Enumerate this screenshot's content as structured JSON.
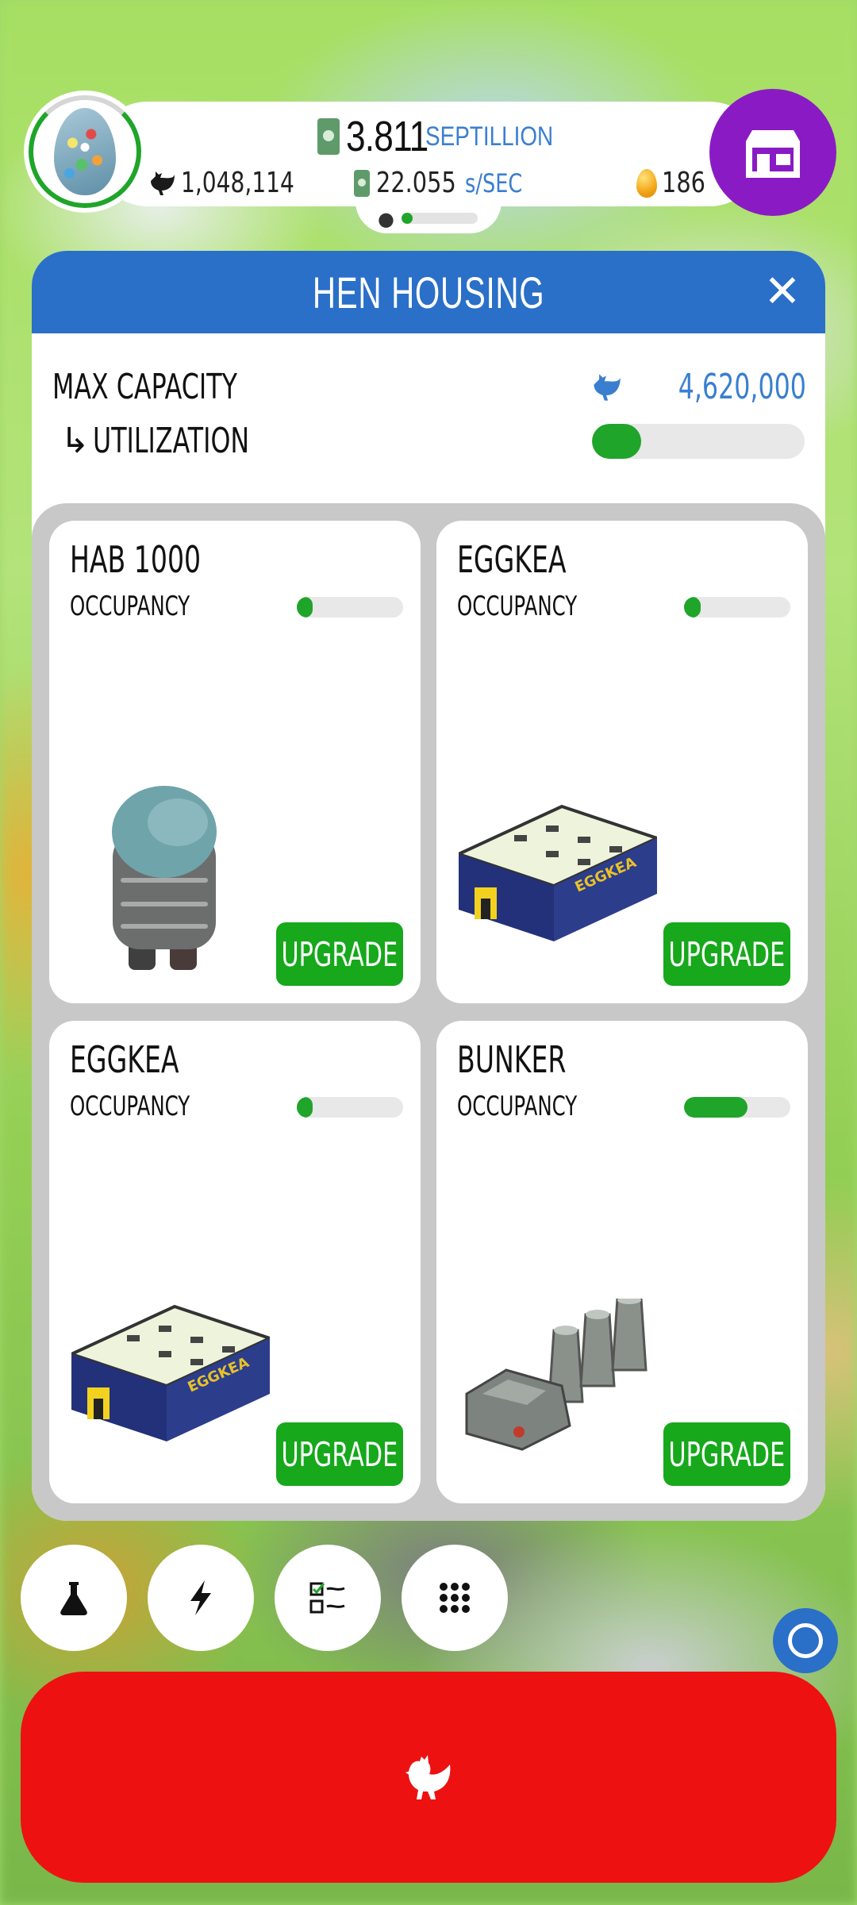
{
  "status_bar": {
    "cash_value": "3.811",
    "cash_unit": "SEPTILLION",
    "rate_value": "22.055",
    "rate_unit": "s/SEC",
    "chicken_count": "1,048,114",
    "golden_eggs": "186",
    "mini_progress_fraction": 0.15
  },
  "panel": {
    "title": "HEN HOUSING",
    "max_capacity_label": "MAX CAPACITY",
    "max_capacity_value": "4,620,000",
    "utilization_label": "UTILIZATION",
    "utilization_arrow": "↳",
    "utilization_fraction": 0.23
  },
  "habs": [
    {
      "name": "HAB 1000",
      "occupancy_label": "OCCUPANCY",
      "occupancy_fraction": 0.08,
      "upgrade_label": "UPGRADE",
      "image": "hab-1000-silo"
    },
    {
      "name": "EGGKEA",
      "occupancy_label": "OCCUPANCY",
      "occupancy_fraction": 0.16,
      "upgrade_label": "UPGRADE",
      "image": "eggkea-warehouse"
    },
    {
      "name": "EGGKEA",
      "occupancy_label": "OCCUPANCY",
      "occupancy_fraction": 0.12,
      "upgrade_label": "UPGRADE",
      "image": "eggkea-warehouse"
    },
    {
      "name": "BUNKER",
      "occupancy_label": "OCCUPANCY",
      "occupancy_fraction": 0.6,
      "upgrade_label": "UPGRADE",
      "image": "bunker"
    }
  ],
  "bottom_buttons": [
    "flask-icon",
    "lightning-icon",
    "checklist-icon",
    "grid-dots-icon"
  ],
  "colors": {
    "header_blue": "#2a6fc8",
    "progress_green": "#17a81c",
    "shop_purple": "#8a1bc4",
    "hatch_red": "#ee1111",
    "accent_blue_text": "#3a7fcf"
  }
}
